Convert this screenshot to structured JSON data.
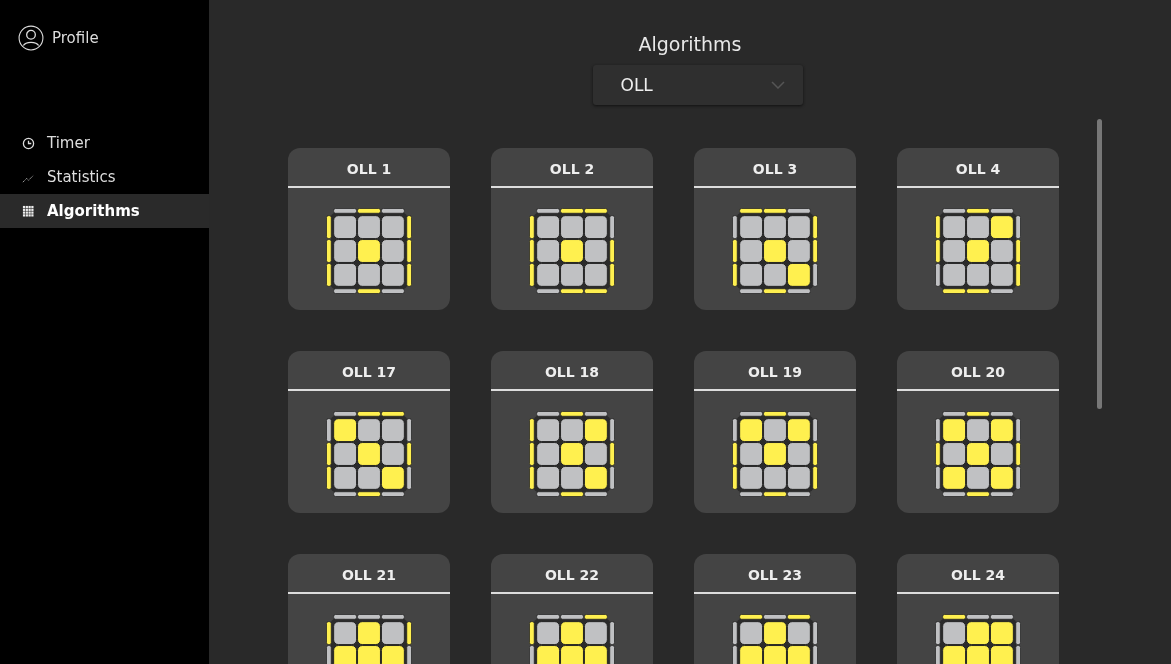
{
  "sidebar": {
    "profile": "Profile",
    "items": [
      {
        "label": "Timer",
        "selected": false
      },
      {
        "label": "Statistics",
        "selected": false
      },
      {
        "label": "Algorithms",
        "selected": true
      }
    ]
  },
  "header": {
    "title": "Algorithms",
    "dropdown": "OLL"
  },
  "cards": [
    {
      "title": "OLL 1",
      "top": [
        false,
        false,
        false,
        false,
        true,
        false,
        false,
        false,
        false
      ],
      "back": [
        false,
        true,
        false
      ],
      "front": [
        false,
        true,
        false
      ],
      "left": [
        true,
        true,
        true
      ],
      "right": [
        true,
        true,
        true
      ]
    },
    {
      "title": "OLL 2",
      "top": [
        false,
        false,
        false,
        false,
        true,
        false,
        false,
        false,
        false
      ],
      "back": [
        false,
        true,
        true
      ],
      "front": [
        false,
        true,
        true
      ],
      "left": [
        true,
        true,
        true
      ],
      "right": [
        false,
        true,
        true
      ]
    },
    {
      "title": "OLL 3",
      "top": [
        false,
        false,
        false,
        false,
        true,
        false,
        false,
        false,
        true
      ],
      "back": [
        true,
        true,
        false
      ],
      "front": [
        false,
        true,
        false
      ],
      "left": [
        false,
        true,
        true
      ],
      "right": [
        true,
        true,
        false
      ]
    },
    {
      "title": "OLL 4",
      "top": [
        false,
        false,
        true,
        false,
        true,
        false,
        false,
        false,
        false
      ],
      "back": [
        false,
        true,
        false
      ],
      "front": [
        true,
        true,
        false
      ],
      "left": [
        true,
        true,
        false
      ],
      "right": [
        false,
        true,
        true
      ]
    },
    {
      "title": "OLL 17",
      "top": [
        true,
        false,
        false,
        false,
        true,
        false,
        false,
        false,
        true
      ],
      "back": [
        false,
        true,
        true
      ],
      "front": [
        false,
        true,
        false
      ],
      "left": [
        false,
        true,
        true
      ],
      "right": [
        false,
        true,
        false
      ]
    },
    {
      "title": "OLL 18",
      "top": [
        false,
        false,
        true,
        false,
        true,
        false,
        false,
        false,
        true
      ],
      "back": [
        false,
        true,
        false
      ],
      "front": [
        false,
        true,
        false
      ],
      "left": [
        true,
        true,
        true
      ],
      "right": [
        false,
        true,
        false
      ]
    },
    {
      "title": "OLL 19",
      "top": [
        true,
        false,
        true,
        false,
        true,
        false,
        false,
        false,
        false
      ],
      "back": [
        false,
        true,
        false
      ],
      "front": [
        false,
        true,
        false
      ],
      "left": [
        false,
        true,
        true
      ],
      "right": [
        false,
        true,
        true
      ]
    },
    {
      "title": "OLL 20",
      "top": [
        true,
        false,
        true,
        false,
        true,
        false,
        true,
        false,
        true
      ],
      "back": [
        false,
        true,
        false
      ],
      "front": [
        false,
        true,
        false
      ],
      "left": [
        false,
        true,
        false
      ],
      "right": [
        false,
        true,
        false
      ]
    },
    {
      "title": "OLL 21",
      "top": [
        false,
        true,
        false,
        true,
        true,
        true
      ],
      "back": [
        false,
        false,
        false
      ],
      "left": [
        true,
        false
      ],
      "right": [
        true,
        false
      ]
    },
    {
      "title": "OLL 22",
      "top": [
        false,
        true,
        false,
        true,
        true,
        true
      ],
      "back": [
        false,
        false,
        true
      ],
      "left": [
        true,
        false
      ],
      "right": [
        false,
        false
      ]
    },
    {
      "title": "OLL 23",
      "top": [
        false,
        true,
        false,
        true,
        true,
        true
      ],
      "back": [
        true,
        false,
        true
      ],
      "left": [
        false,
        false
      ],
      "right": [
        false,
        false
      ]
    },
    {
      "title": "OLL 24",
      "top": [
        false,
        true,
        true,
        true,
        true,
        true
      ],
      "back": [
        true,
        false,
        false
      ],
      "left": [
        false,
        false
      ],
      "right": [
        false,
        false
      ]
    }
  ]
}
